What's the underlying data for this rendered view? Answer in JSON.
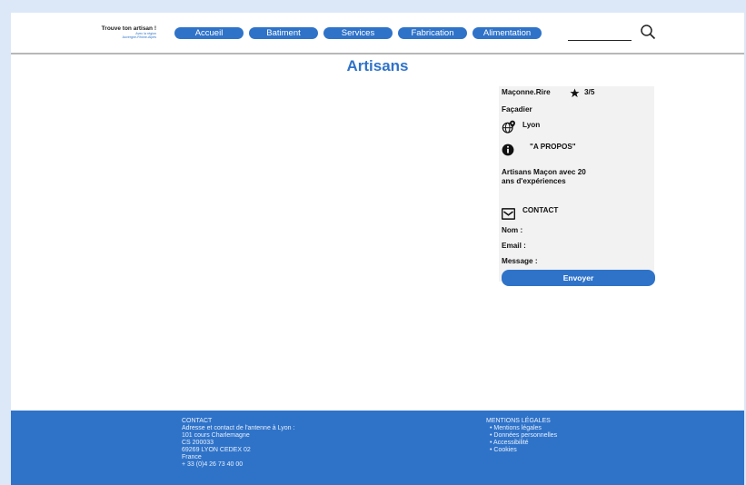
{
  "logo": {
    "title": "Trouve ton artisan !",
    "subtitle_1": "Avec la région",
    "subtitle_2": "Auvergne-Rhône-Alpes"
  },
  "nav": [
    {
      "label": "Accueil"
    },
    {
      "label": "Batiment"
    },
    {
      "label": "Services"
    },
    {
      "label": "Fabrication"
    },
    {
      "label": "Alimentation"
    }
  ],
  "search": {
    "placeholder": "",
    "icon": "search-icon"
  },
  "page": {
    "title": "Artisans"
  },
  "artisan": {
    "name": "Maçonne.Rire",
    "rating": "3/5",
    "specialty": "Façadier",
    "city": "Lyon",
    "about_heading": "\"A PROPOS\"",
    "about_line_1": "Artisans Maçon avec  20",
    "about_line_2": "ans d'expériences",
    "contact_heading": "CONTACT",
    "name_label": "Nom :",
    "email_label": "Email :",
    "message_label": "Message :",
    "send_label": "Envoyer"
  },
  "footer": {
    "contact": {
      "heading": "CONTACT",
      "lines": [
        "Adresse et contact de l'antenne à Lyon :",
        "101 cours Charlemagne",
        "CS 200033",
        "69269 LYON CEDEX 02",
        "France",
        "+ 33 (0)4 26 73 40 00"
      ]
    },
    "legal": {
      "heading": "MENTIONS LÉGALES",
      "items": [
        "Mentions légales",
        "Données personnelles",
        "Accessibilité",
        "Cookies"
      ]
    }
  },
  "colors": {
    "accent": "#2f73c9",
    "background": "#dce8f8",
    "card": "#f2f2f2"
  }
}
